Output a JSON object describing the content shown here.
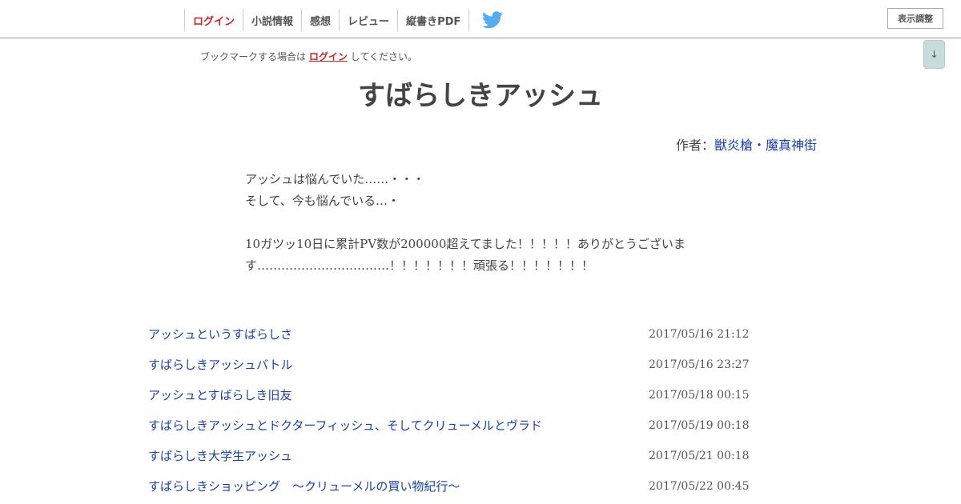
{
  "nav": {
    "items": [
      {
        "label": "ログイン"
      },
      {
        "label": "小説情報"
      },
      {
        "label": "感想"
      },
      {
        "label": "レビュー"
      },
      {
        "label": "縦書きPDF"
      }
    ],
    "twitter_icon": "twitter-bird-icon",
    "display_settings_label": "表示調整",
    "scroll_down_label": "↓"
  },
  "colors": {
    "login_red": "#cc2222",
    "link_blue": "#1a3fae",
    "twitter_blue": "#55acee",
    "text_gray": "#444444"
  },
  "bookmark": {
    "prefix": "ブックマークする場合は",
    "link": "ログイン",
    "suffix": "してください。"
  },
  "novel": {
    "title": "すばらしきアッシュ",
    "author_label": "作者：",
    "author_name": "獣炎槍・魔真神街"
  },
  "synopsis": {
    "lines": [
      "アッシュは悩んでいた……・・・",
      "そして、今も悩んでいる…・",
      "",
      "10ガツッ10日に累計PV数が200000超えてました！！！！！ありがとうございま",
      "す……………………………！！！！！！！頑張る！！！！！！！"
    ]
  },
  "chapters": [
    {
      "title": "アッシュというすばらしさ",
      "date": "2017/05/16 21:12"
    },
    {
      "title": "すばらしきアッシュバトル",
      "date": "2017/05/16 23:27"
    },
    {
      "title": "アッシュとすばらしき旧友",
      "date": "2017/05/18 00:15"
    },
    {
      "title": "すばらしきアッシュとドクターフィッシュ、そしてクリューメルとヴラド",
      "date": "2017/05/19 00:18"
    },
    {
      "title": "すばらしき大学生アッシュ",
      "date": "2017/05/21 00:18"
    },
    {
      "title": "すばらしきショッピング　～クリューメルの買い物紀行～",
      "date": "2017/05/22 00:45"
    }
  ]
}
